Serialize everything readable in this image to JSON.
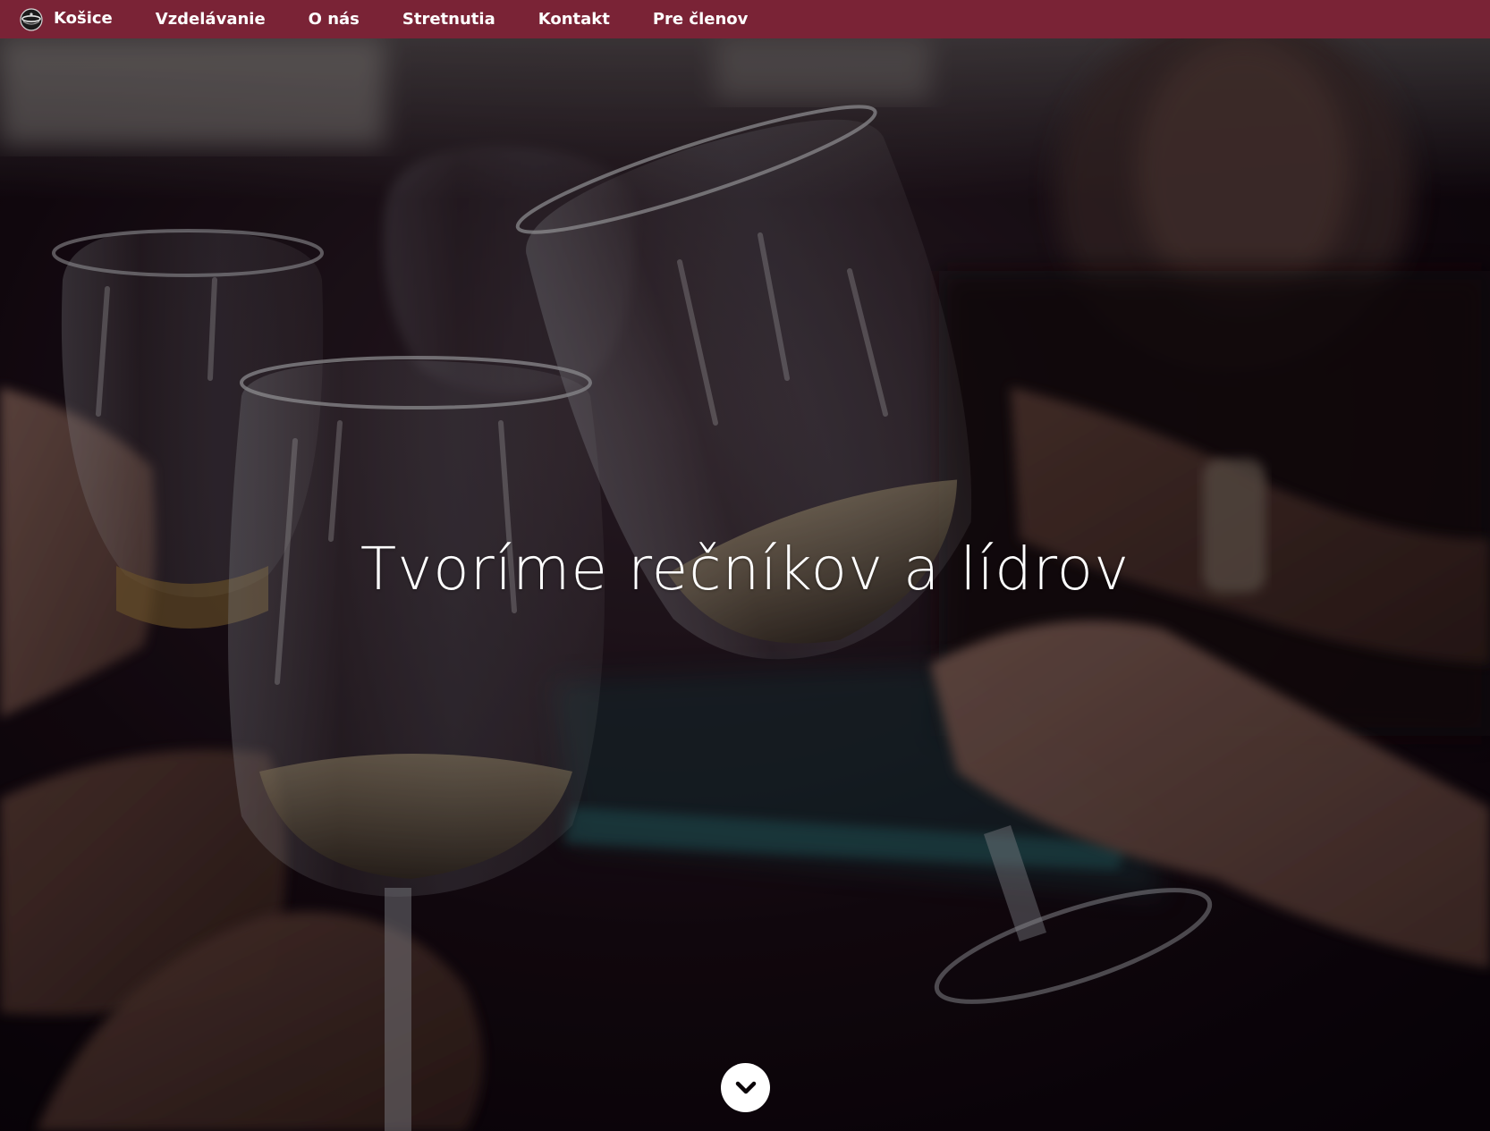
{
  "nav": {
    "brand": {
      "label": "Košice",
      "icon": "toastmasters-logo-icon"
    },
    "items": [
      {
        "label": "Vzdelávanie"
      },
      {
        "label": "O nás"
      },
      {
        "label": "Stretnutia"
      },
      {
        "label": "Kontakt"
      },
      {
        "label": "Pre členov"
      }
    ],
    "background_color": "#7a2336",
    "text_color": "#ffffff"
  },
  "hero": {
    "title": "Tvoríme rečníkov a lídrov",
    "background_image": "hands-toasting-wine-glasses",
    "scroll_icon": "chevron-down-icon"
  }
}
